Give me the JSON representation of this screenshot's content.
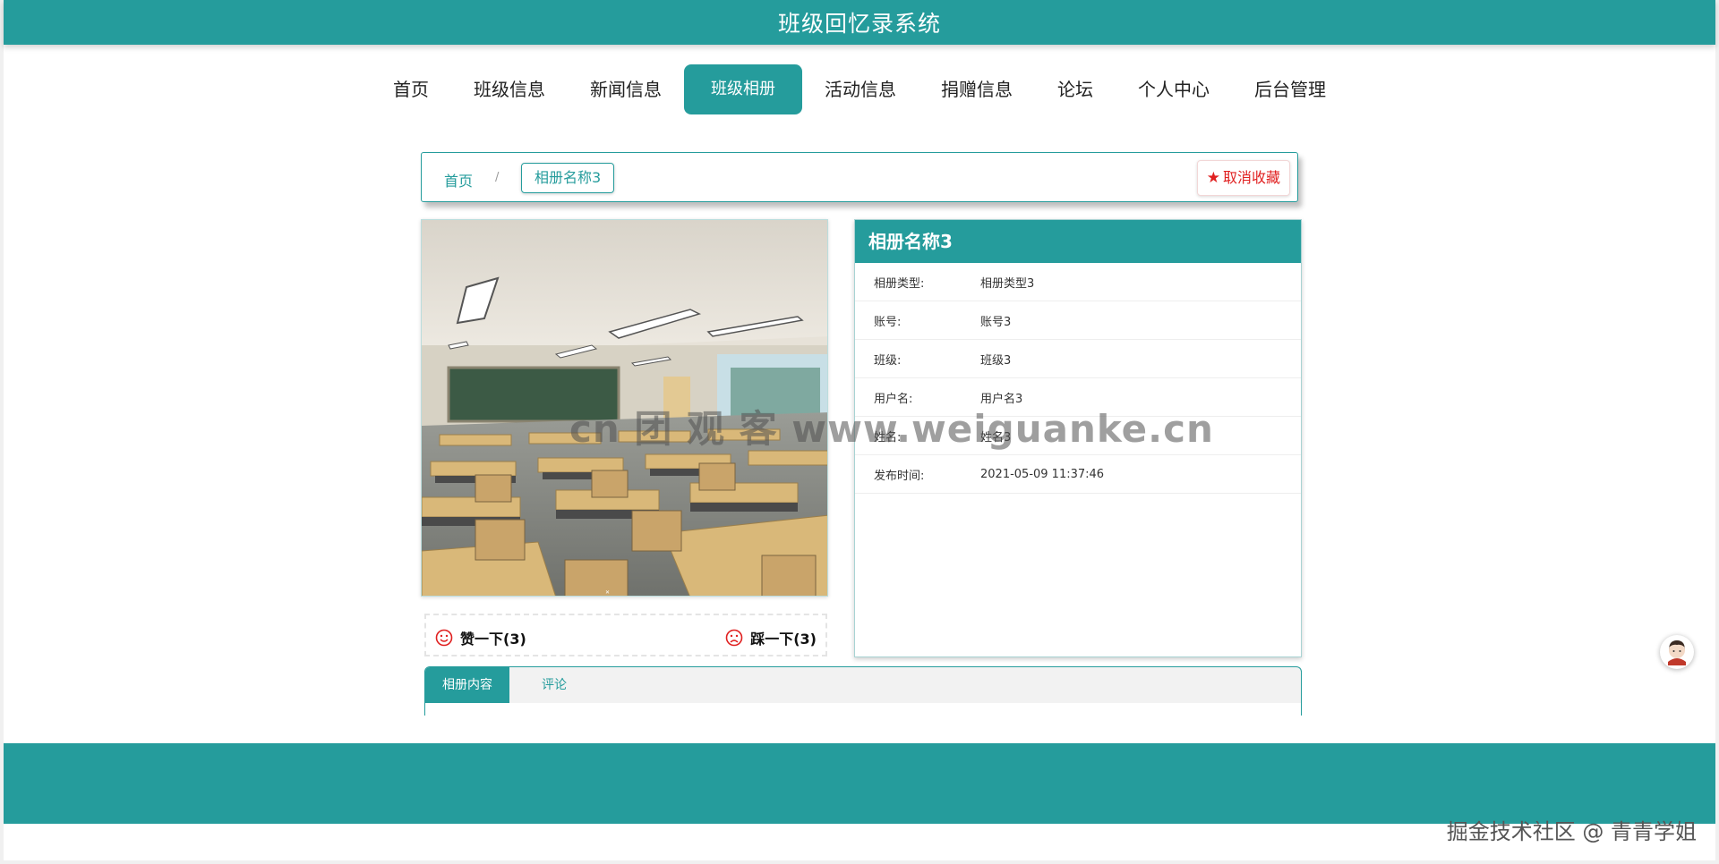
{
  "header": {
    "title": "班级回忆录系统"
  },
  "nav": {
    "items": [
      {
        "label": "首页",
        "active": false
      },
      {
        "label": "班级信息",
        "active": false
      },
      {
        "label": "新闻信息",
        "active": false
      },
      {
        "label": "班级相册",
        "active": true
      },
      {
        "label": "活动信息",
        "active": false
      },
      {
        "label": "捐赠信息",
        "active": false
      },
      {
        "label": "论坛",
        "active": false
      },
      {
        "label": "个人中心",
        "active": false
      },
      {
        "label": "后台管理",
        "active": false
      }
    ]
  },
  "breadcrumb": {
    "home": "首页",
    "separator": "/",
    "current": "相册名称3"
  },
  "favorite": {
    "label": "取消收藏",
    "icon": "star-icon"
  },
  "votes": {
    "up_label": "赞一下(3)",
    "down_label": "踩一下(3)"
  },
  "info": {
    "title": "相册名称3",
    "rows": [
      {
        "label": "相册类型:",
        "value": "相册类型3"
      },
      {
        "label": "账号:",
        "value": "账号3"
      },
      {
        "label": "班级:",
        "value": "班级3"
      },
      {
        "label": "用户名:",
        "value": "用户名3"
      },
      {
        "label": "姓名:",
        "value": "姓名3"
      },
      {
        "label": "发布时间:",
        "value": "2021-05-09 11:37:46"
      }
    ]
  },
  "tabs": {
    "content_label": "相册内容",
    "comment_label": "评论"
  },
  "overlay": {
    "watermark": "cn 团 观 客 www.weiguanke.cn",
    "credit": "掘金技术社区 @ 青青学姐"
  },
  "colors": {
    "accent": "#259c9c",
    "favorite": "#e02020"
  }
}
